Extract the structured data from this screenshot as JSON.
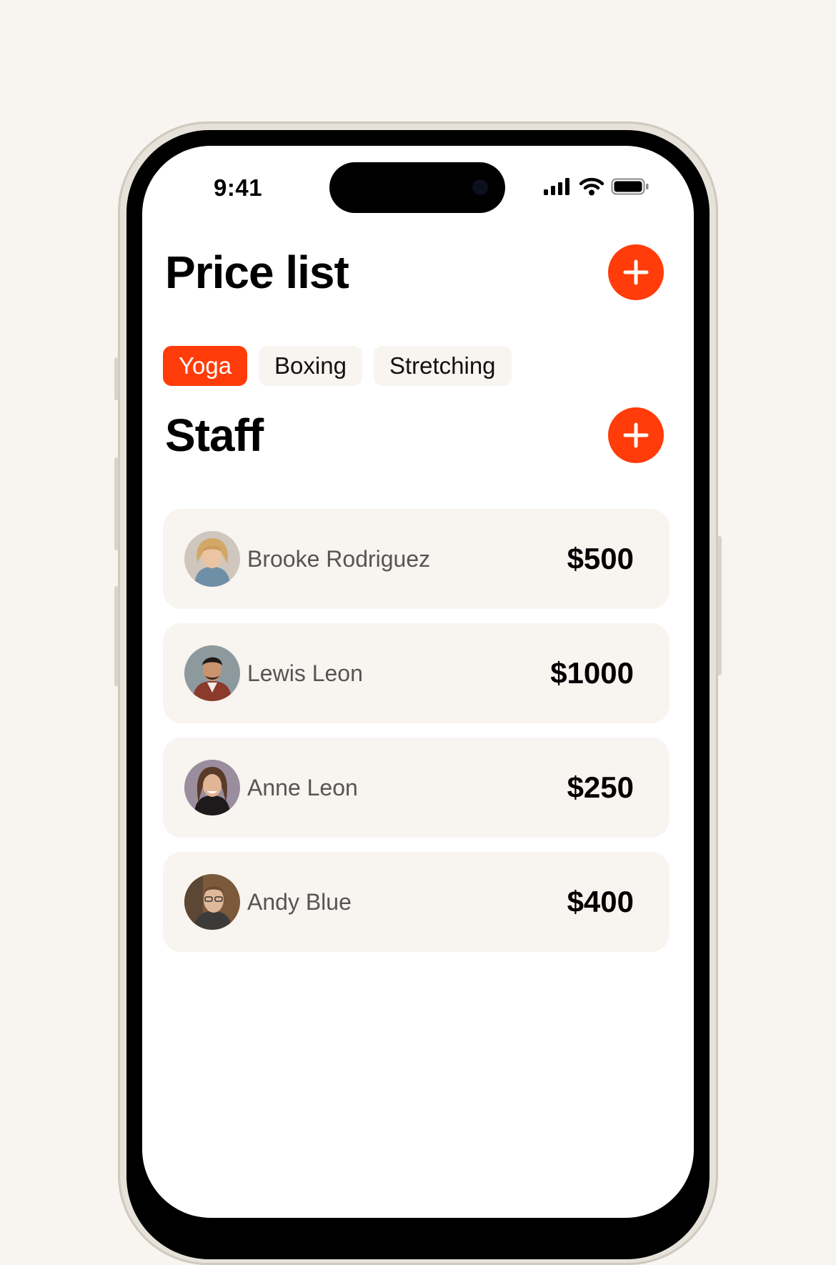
{
  "status_bar": {
    "time": "9:41"
  },
  "price_list": {
    "title": "Price list",
    "add_icon": "plus-icon",
    "tabs": [
      {
        "label": "Yoga",
        "active": true
      },
      {
        "label": "Boxing",
        "active": false
      },
      {
        "label": "Stretching",
        "active": false
      }
    ]
  },
  "staff": {
    "title": "Staff",
    "add_icon": "plus-icon",
    "members": [
      {
        "name": "Brooke Rodriguez",
        "price": "$500"
      },
      {
        "name": "Lewis Leon",
        "price": "$1000"
      },
      {
        "name": "Anne Leon",
        "price": "$250"
      },
      {
        "name": "Andy Blue",
        "price": "$400"
      }
    ]
  },
  "colors": {
    "accent": "#ff3c0a",
    "background": "#f8f4f0",
    "card": "#f8f4f0",
    "text": "#000000",
    "muted_text": "#555555"
  }
}
